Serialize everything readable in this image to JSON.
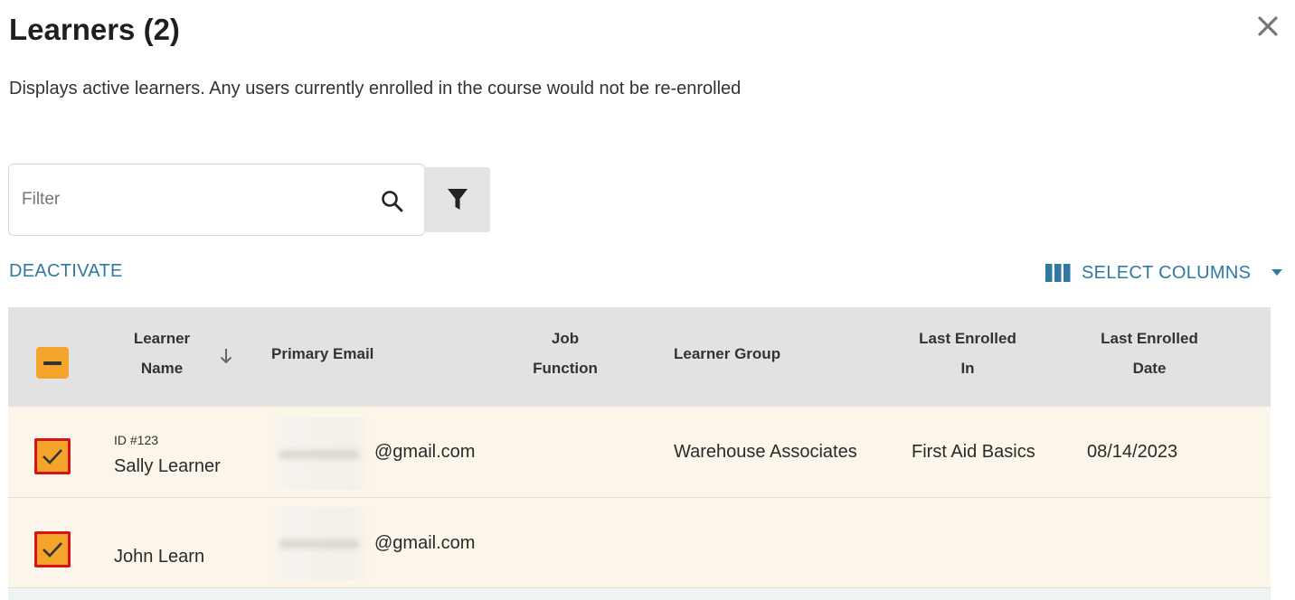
{
  "header": {
    "title": "Learners (2)",
    "description": "Displays active learners. Any users currently enrolled in the course would not be re-enrolled"
  },
  "filter": {
    "placeholder": "Filter",
    "value": ""
  },
  "actions": {
    "deactivate_label": "DEACTIVATE",
    "select_columns_label": "SELECT COLUMNS"
  },
  "table": {
    "columns": [
      {
        "line1": "Learner",
        "line2": "Name"
      },
      {
        "line1": "Primary Email",
        "line2": ""
      },
      {
        "line1": "Job",
        "line2": "Function"
      },
      {
        "line1": "Learner Group",
        "line2": ""
      },
      {
        "line1": "Last Enrolled",
        "line2": "In"
      },
      {
        "line1": "Last Enrolled",
        "line2": "Date"
      }
    ],
    "rows": [
      {
        "selected": true,
        "id_label": "ID #123",
        "name": "Sally Learner",
        "email": "@gmail.com",
        "job_function": "",
        "learner_group": "Warehouse Associates",
        "last_enrolled_in": "First Aid Basics",
        "last_enrolled_date": "08/14/2023"
      },
      {
        "selected": true,
        "id_label": "",
        "name": "John Learn",
        "email": "@gmail.com",
        "job_function": "",
        "learner_group": "",
        "last_enrolled_in": "",
        "last_enrolled_date": ""
      }
    ]
  },
  "colors": {
    "accent_link": "#2f7aa0",
    "checkbox_fill": "#f4a42a",
    "checkbox_border": "#d8121b",
    "row_selected_bg": "#fcf5ea",
    "header_bg": "#e2e2e2"
  },
  "icons": {
    "close": "close-icon",
    "search": "search-icon",
    "filter": "filter-funnel-icon",
    "columns": "columns-icon",
    "caret": "caret-down-icon",
    "sort": "arrow-down-icon",
    "check": "check-icon",
    "indeterminate": "minus-icon"
  }
}
